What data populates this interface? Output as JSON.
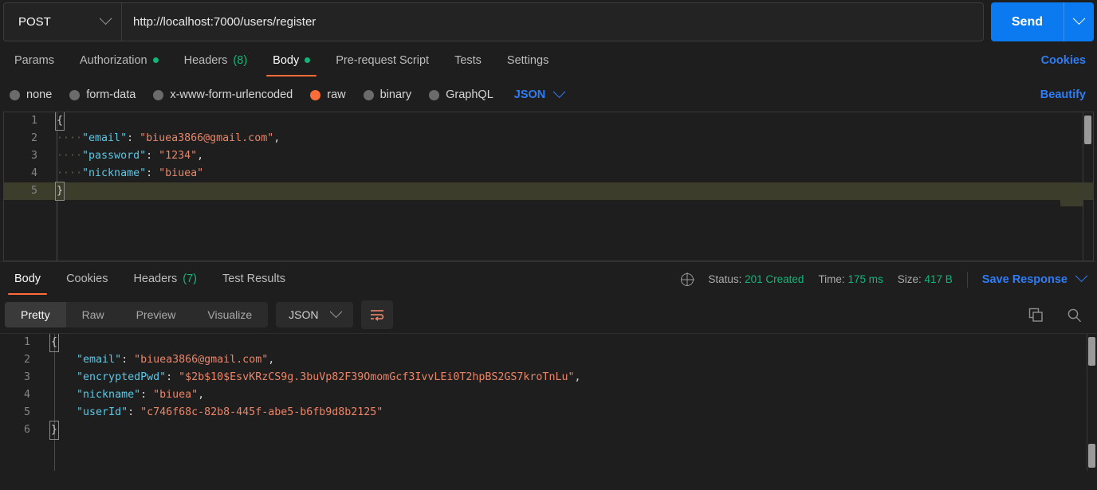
{
  "request": {
    "method": "POST",
    "url": "http://localhost:7000/users/register",
    "send_label": "Send",
    "tabs": [
      {
        "label": "Params",
        "indicator": "",
        "active": false
      },
      {
        "label": "Authorization",
        "indicator": "dot",
        "active": false
      },
      {
        "label": "Headers",
        "indicator": "(8)",
        "active": false
      },
      {
        "label": "Body",
        "indicator": "dot",
        "active": true
      },
      {
        "label": "Pre-request Script",
        "indicator": "",
        "active": false
      },
      {
        "label": "Tests",
        "indicator": "",
        "active": false
      },
      {
        "label": "Settings",
        "indicator": "",
        "active": false
      }
    ],
    "cookies_link": "Cookies",
    "beautify_link": "Beautify",
    "body_types": [
      {
        "label": "none",
        "selected": false
      },
      {
        "label": "form-data",
        "selected": false
      },
      {
        "label": "x-www-form-urlencoded",
        "selected": false
      },
      {
        "label": "raw",
        "selected": true
      },
      {
        "label": "binary",
        "selected": false
      },
      {
        "label": "GraphQL",
        "selected": false
      }
    ],
    "raw_format": "JSON",
    "body_lines": [
      {
        "num": "1",
        "type": "open",
        "text": "{"
      },
      {
        "num": "2",
        "type": "kv",
        "key": "\"email\"",
        "value": "\"biuea3866@gmail.com\"",
        "comma": ","
      },
      {
        "num": "3",
        "type": "kv",
        "key": "\"password\"",
        "value": "\"1234\"",
        "comma": ","
      },
      {
        "num": "4",
        "type": "kv",
        "key": "\"nickname\"",
        "value": "\"biuea\"",
        "comma": ""
      },
      {
        "num": "5",
        "type": "close",
        "text": "}",
        "highlight": true
      }
    ]
  },
  "response": {
    "tabs": [
      {
        "label": "Body",
        "indicator": "",
        "active": true
      },
      {
        "label": "Cookies",
        "indicator": "",
        "active": false
      },
      {
        "label": "Headers",
        "indicator": "(7)",
        "active": false
      },
      {
        "label": "Test Results",
        "indicator": "",
        "active": false
      }
    ],
    "status_label": "Status:",
    "status_value": "201 Created",
    "time_label": "Time:",
    "time_value": "175 ms",
    "size_label": "Size:",
    "size_value": "417 B",
    "save_response": "Save Response",
    "view_modes": [
      {
        "label": "Pretty",
        "active": true
      },
      {
        "label": "Raw",
        "active": false
      },
      {
        "label": "Preview",
        "active": false
      },
      {
        "label": "Visualize",
        "active": false
      }
    ],
    "format": "JSON",
    "body_lines": [
      {
        "num": "1",
        "type": "open",
        "text": "{"
      },
      {
        "num": "2",
        "type": "kv",
        "key": "\"email\"",
        "value": "\"biuea3866@gmail.com\"",
        "comma": ","
      },
      {
        "num": "3",
        "type": "kv",
        "key": "\"encryptedPwd\"",
        "value": "\"$2b$10$EsvKRzCS9g.3buVp82F39OmomGcf3IvvLEi0T2hpBS2GS7kroTnLu\"",
        "comma": ","
      },
      {
        "num": "4",
        "type": "kv",
        "key": "\"nickname\"",
        "value": "\"biuea\"",
        "comma": ","
      },
      {
        "num": "5",
        "type": "kv",
        "key": "\"userId\"",
        "value": "\"c746f68c-82b8-445f-abe5-b6fb9d8b2125\"",
        "comma": ""
      },
      {
        "num": "6",
        "type": "close",
        "text": "}"
      }
    ]
  },
  "colors": {
    "accent": "#ff6c37",
    "link": "#2f7df6",
    "success": "#11b579",
    "send": "#0b79ef",
    "key": "#5bc8e6",
    "string": "#e8866a"
  }
}
